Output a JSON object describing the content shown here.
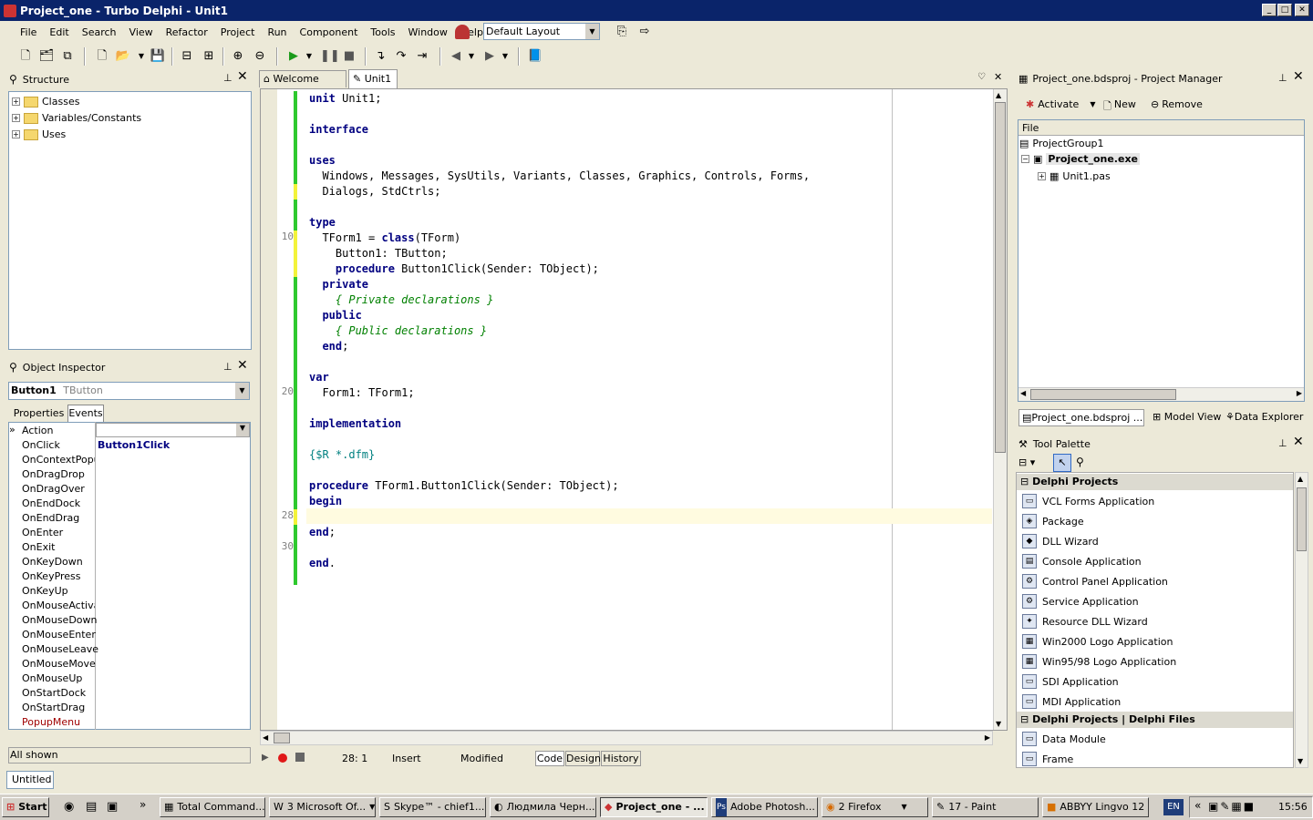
{
  "window": {
    "title": "Project_one - Turbo Delphi - Unit1"
  },
  "menu": [
    "File",
    "Edit",
    "Search",
    "View",
    "Refactor",
    "Project",
    "Run",
    "Component",
    "Tools",
    "Window",
    "Help"
  ],
  "layout_combo": "Default Layout",
  "structure": {
    "title": "Structure",
    "items": [
      "Classes",
      "Variables/Constants",
      "Uses"
    ]
  },
  "inspector": {
    "title": "Object Inspector",
    "selected_name": "Button1",
    "selected_type": "TButton",
    "tabs": [
      "Properties",
      "Events"
    ],
    "events": [
      "Action",
      "OnClick",
      "OnContextPopup",
      "OnDragDrop",
      "OnDragOver",
      "OnEndDock",
      "OnEndDrag",
      "OnEnter",
      "OnExit",
      "OnKeyDown",
      "OnKeyPress",
      "OnKeyUp",
      "OnMouseActivate",
      "OnMouseDown",
      "OnMouseEnter",
      "OnMouseLeave",
      "OnMouseMove",
      "OnMouseUp",
      "OnStartDock",
      "OnStartDrag",
      "PopupMenu"
    ],
    "onclick_value": "Button1Click",
    "footer": "All shown"
  },
  "editor": {
    "tabs": [
      "Welcome Page",
      "Unit1"
    ],
    "line_numbers": [
      "10",
      "20",
      "28",
      "30"
    ],
    "status": {
      "position": "28:   1",
      "mode": "Insert",
      "state": "Modified"
    },
    "bottom_tabs": [
      "Code",
      "Design",
      "History"
    ]
  },
  "project_manager": {
    "title": "Project_one.bdsproj - Project Manager",
    "buttons": [
      "Activate",
      "New",
      "Remove"
    ],
    "column": "File",
    "tree": [
      "ProjectGroup1",
      "Project_one.exe",
      "Unit1.pas"
    ],
    "tabs": [
      "Project_one.bdsproj ...",
      "Model View",
      "Data Explorer"
    ]
  },
  "tool_palette": {
    "title": "Tool Palette",
    "section1": "Delphi Projects",
    "items1": [
      "VCL Forms Application",
      "Package",
      "DLL Wizard",
      "Console Application",
      "Control Panel Application",
      "Service Application",
      "Resource DLL Wizard",
      "Win2000 Logo Application",
      "Win95/98 Logo Application",
      "SDI Application",
      "MDI Application"
    ],
    "section2": "Delphi Projects | Delphi Files",
    "items2": [
      "Data Module",
      "Frame"
    ]
  },
  "bottom_field": "Untitled",
  "taskbar": {
    "start": "Start",
    "tasks": [
      "Total Command...",
      "3 Microsoft Of...",
      "Skype™ - chief1...",
      "Людмила Черн...",
      "Project_one - ...",
      "Adobe Photosh...",
      "2 Firefox",
      "17 - Paint",
      "ABBYY Lingvo 12"
    ],
    "lang": "EN",
    "clock": "15:56"
  }
}
